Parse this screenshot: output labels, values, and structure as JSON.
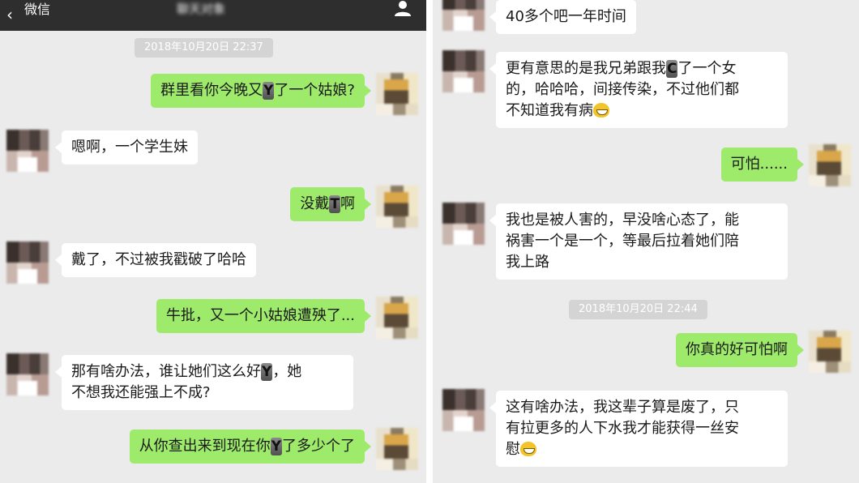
{
  "left_screen": {
    "header": {
      "back_label": "微信",
      "chat_title": "聊天对象"
    },
    "timestamp": "2018年10月20日 22:37",
    "messages": [
      {
        "side": "out",
        "parts": [
          "群里看你今晚又",
          "Y",
          "了一个姑娘?"
        ]
      },
      {
        "side": "in",
        "text": "嗯啊，一个学生妹"
      },
      {
        "side": "out",
        "parts": [
          "没戴",
          "T",
          "啊"
        ]
      },
      {
        "side": "in",
        "text": "戴了，不过被我戳破了哈哈"
      },
      {
        "side": "out",
        "text": "牛批，又一个小姑娘遭殃了..."
      },
      {
        "side": "in",
        "parts": [
          "那有啥办法，谁让她们这么好",
          "Y",
          "，她\n不想我还能强上不成?"
        ]
      },
      {
        "side": "out",
        "parts": [
          "从你查出来到现在你",
          "Y",
          "了多少个了"
        ]
      }
    ]
  },
  "right_screen": {
    "timestamp": "2018年10月20日 22:44",
    "messages": [
      {
        "side": "in",
        "text": "40多个吧一年时间"
      },
      {
        "side": "in",
        "parts": [
          "更有意思的是我兄弟跟我",
          "C",
          "了一个女\n的，哈哈哈，间接传染，不过他们都\n不知道我有病"
        ],
        "emoji": "grin-emoji"
      },
      {
        "side": "out",
        "text": "可怕......"
      },
      {
        "side": "in",
        "text": "我也是被人害的，早没啥心态了，能\n祸害一个是一个，等最后拉着她们陪\n我上路"
      },
      {
        "side": "out",
        "text": "你真的好可怕啊"
      },
      {
        "side": "in",
        "text": "这有啥办法，我这辈子算是废了，只\n有拉更多的人下水我才能获得一丝安\n慰",
        "emoji": "grin-emoji"
      }
    ]
  },
  "colors": {
    "chat_background": "#ebebeb",
    "outgoing_bubble": "#9eea6a",
    "incoming_bubble": "#ffffff",
    "header_bar": "#2e2e2e",
    "timestamp_pill": "#d4d4d4"
  },
  "icons": {
    "back": "back-arrow-icon",
    "profile": "person-icon",
    "emoji": "grin-emoji"
  }
}
